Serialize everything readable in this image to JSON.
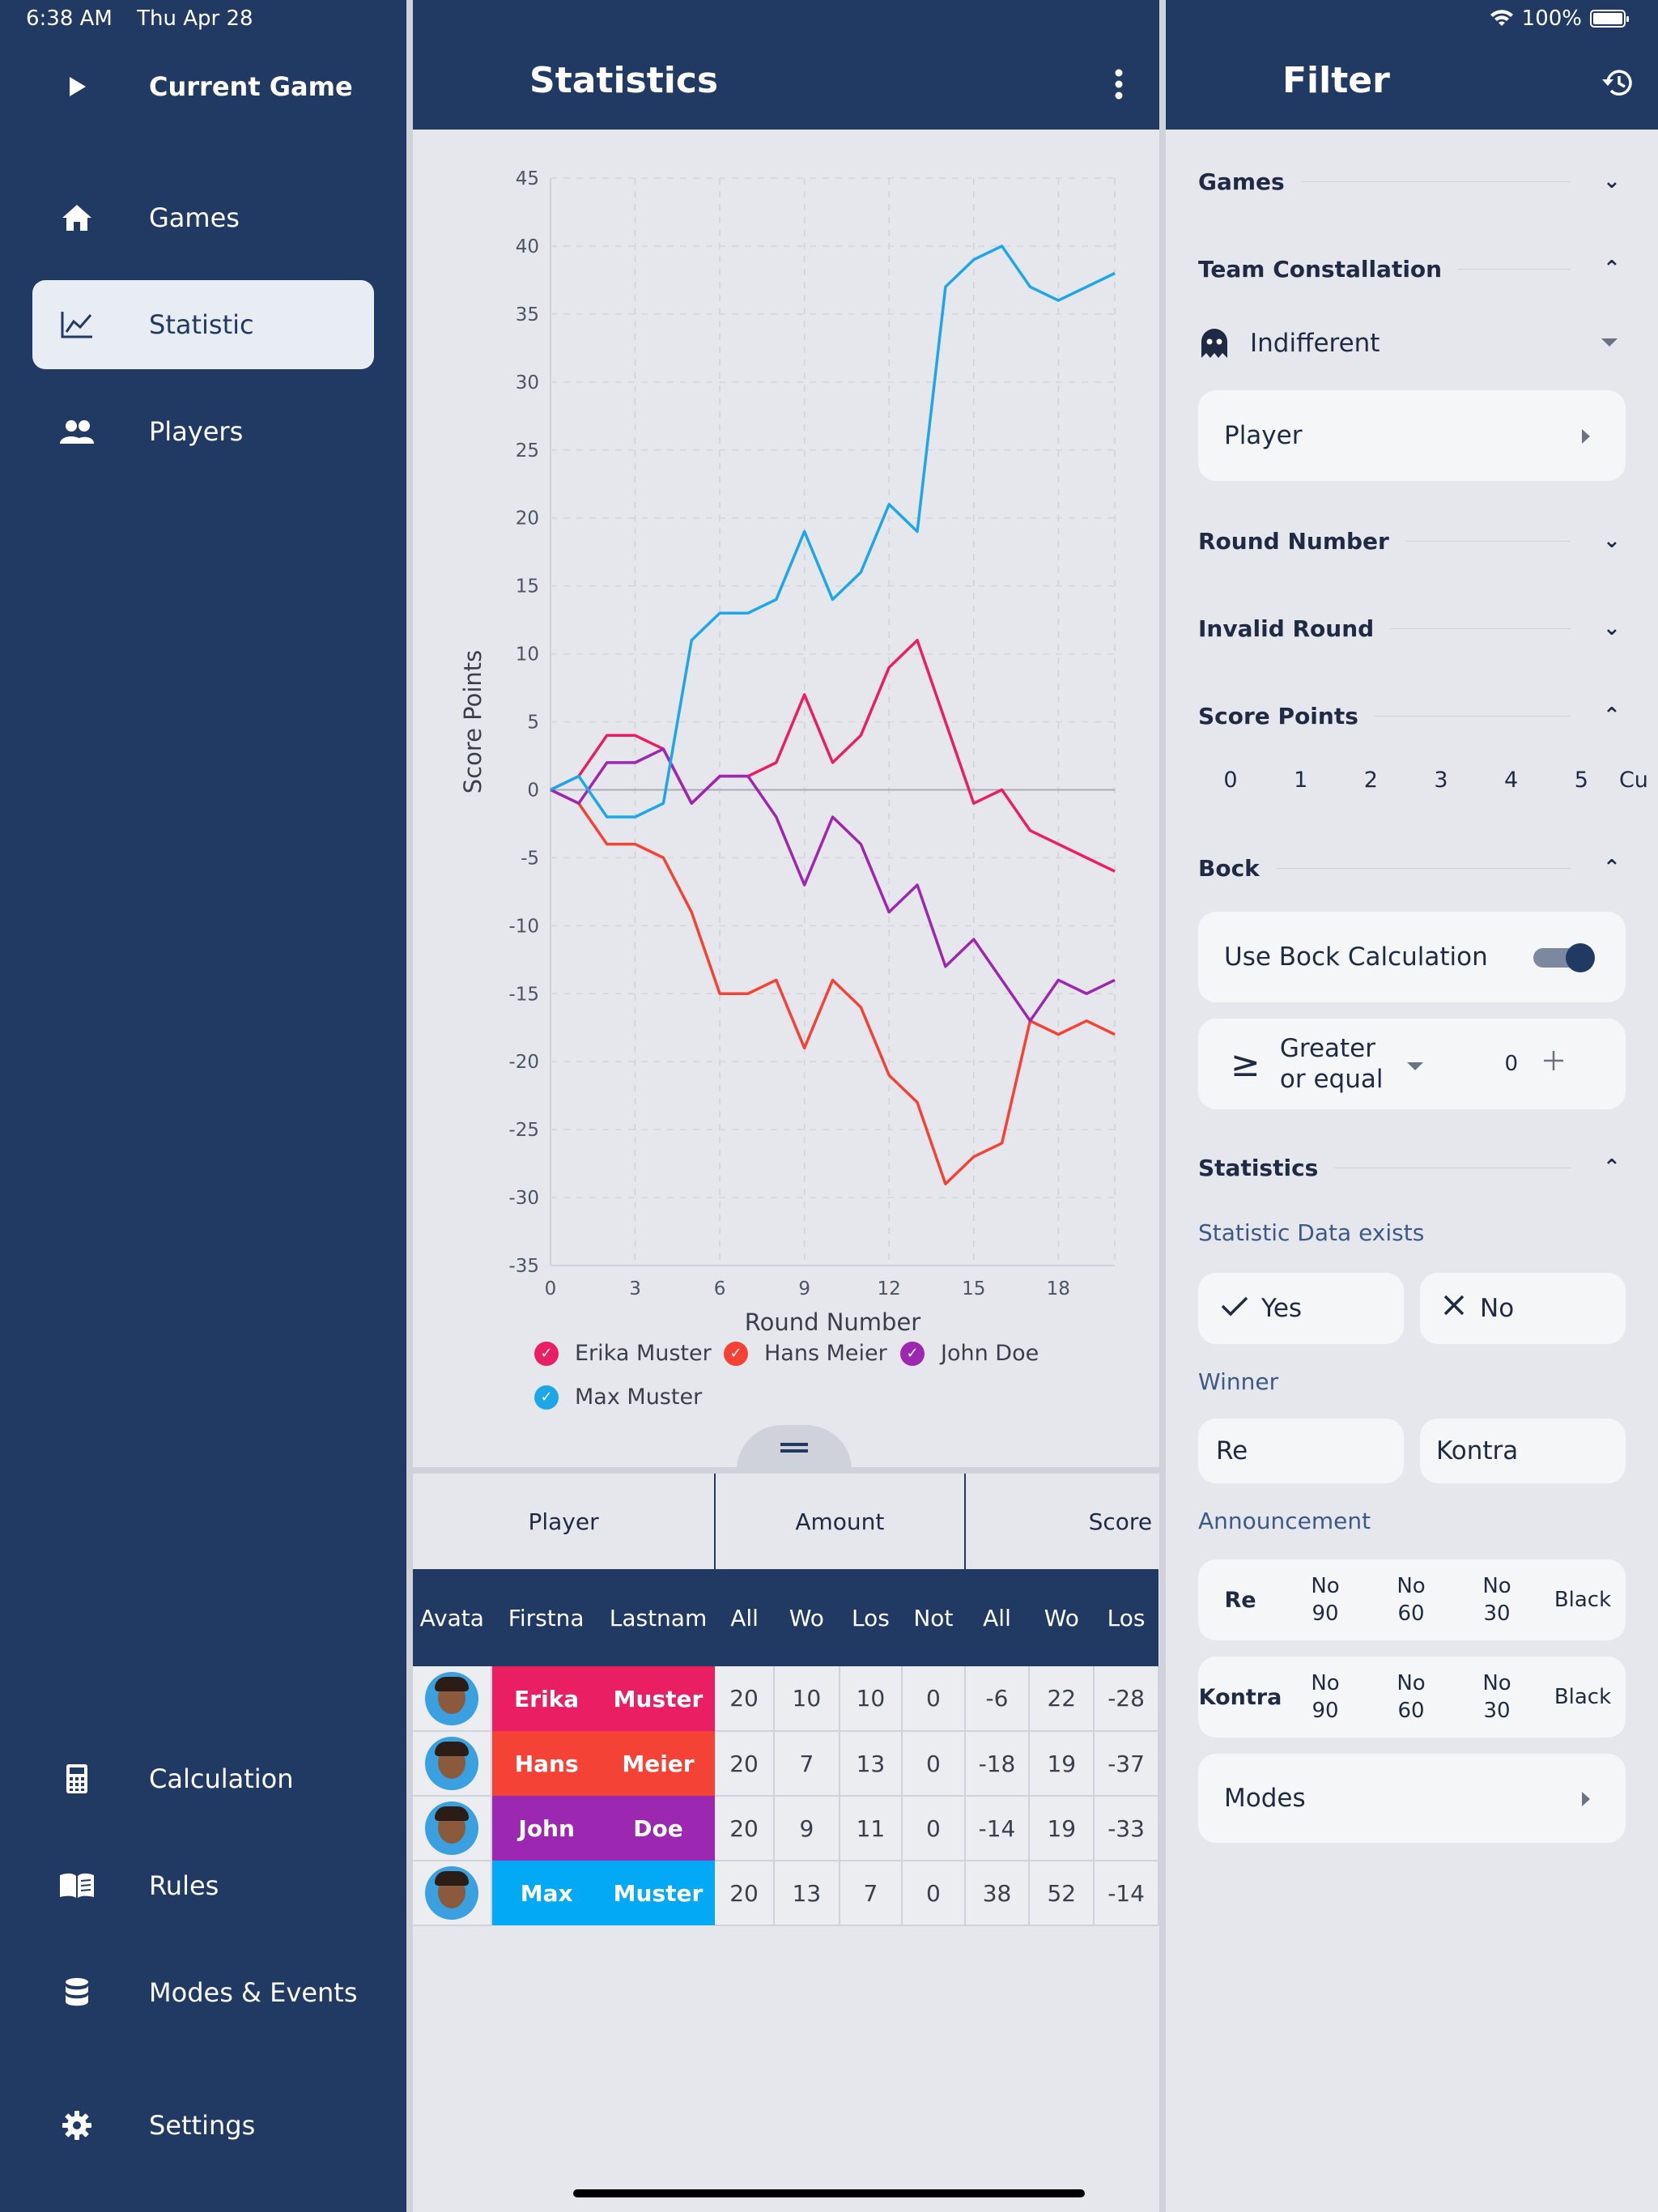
{
  "status": {
    "time": "6:38 AM",
    "date": "Thu Apr 28",
    "battery": "100%"
  },
  "sidebar": {
    "current_game": "Current Game",
    "items": [
      {
        "label": "Games",
        "icon": "home-icon"
      },
      {
        "label": "Statistic",
        "icon": "chart-icon",
        "active": true
      },
      {
        "label": "Players",
        "icon": "people-icon"
      }
    ],
    "bottom_items": [
      {
        "label": "Calculation",
        "icon": "calculator-icon"
      },
      {
        "label": "Rules",
        "icon": "book-icon"
      },
      {
        "label": "Modes & Events",
        "icon": "database-icon"
      },
      {
        "label": "Settings",
        "icon": "gear-icon"
      }
    ]
  },
  "statistics": {
    "title": "Statistics",
    "table": {
      "groups": [
        "Player",
        "Amount",
        "Score"
      ],
      "columns": [
        "Avata",
        "Firstna",
        "Lastnam",
        "All",
        "Wo",
        "Los",
        "Not",
        "All",
        "Wo",
        "Los"
      ],
      "rows": [
        {
          "first": "Erika",
          "last": "Muster",
          "color": "#e91e63",
          "vals": [
            "20",
            "10",
            "10",
            "0",
            "-6",
            "22",
            "-28"
          ]
        },
        {
          "first": "Hans",
          "last": "Meier",
          "color": "#f44336",
          "vals": [
            "20",
            "7",
            "13",
            "0",
            "-18",
            "19",
            "-37"
          ]
        },
        {
          "first": "John",
          "last": "Doe",
          "color": "#9c27b0",
          "vals": [
            "20",
            "9",
            "11",
            "0",
            "-14",
            "19",
            "-33"
          ]
        },
        {
          "first": "Max",
          "last": "Muster",
          "color": "#03a9f4",
          "vals": [
            "20",
            "13",
            "7",
            "0",
            "38",
            "52",
            "-14"
          ]
        }
      ]
    }
  },
  "chart_data": {
    "type": "line",
    "xlabel": "Round Number",
    "ylabel": "Score Points",
    "xlim": [
      0,
      20
    ],
    "ylim": [
      -35,
      45
    ],
    "x_ticks": [
      0,
      3,
      6,
      9,
      12,
      15,
      18
    ],
    "y_ticks": [
      45,
      40,
      35,
      30,
      25,
      20,
      15,
      10,
      5,
      0,
      -5,
      -10,
      -15,
      -20,
      -25,
      -30,
      -35
    ],
    "grid": true,
    "legend_position": "bottom",
    "x": [
      0,
      1,
      2,
      3,
      4,
      5,
      6,
      7,
      8,
      9,
      10,
      11,
      12,
      13,
      14,
      15,
      16,
      17,
      18,
      19,
      20
    ],
    "series": [
      {
        "name": "Erika Muster",
        "color": "#e91e63",
        "values": [
          0,
          1,
          4,
          4,
          3,
          -1,
          1,
          1,
          2,
          7,
          2,
          4,
          9,
          11,
          5,
          -1,
          0,
          -3,
          -4,
          -5,
          -6
        ]
      },
      {
        "name": "Hans Meier",
        "color": "#f44336",
        "values": [
          0,
          -1,
          -4,
          -4,
          -5,
          -9,
          -15,
          -15,
          -14,
          -19,
          -14,
          -16,
          -21,
          -23,
          -29,
          -27,
          -26,
          -17,
          -18,
          -17,
          -18
        ]
      },
      {
        "name": "John Doe",
        "color": "#9c27b0",
        "values": [
          0,
          -1,
          2,
          2,
          3,
          -1,
          1,
          1,
          -2,
          -7,
          -2,
          -4,
          -9,
          -7,
          -13,
          -11,
          -14,
          -17,
          -14,
          -15,
          -14
        ]
      },
      {
        "name": "Max Muster",
        "color": "#1ea7e8",
        "values": [
          0,
          1,
          -2,
          -2,
          -1,
          11,
          13,
          13,
          14,
          19,
          14,
          16,
          21,
          19,
          37,
          39,
          40,
          37,
          36,
          37,
          38
        ]
      }
    ]
  },
  "filter": {
    "title": "Filter",
    "sections": {
      "games": "Games",
      "team": "Team Constallation",
      "round": "Round Number",
      "invalid": "Invalid Round",
      "score": "Score Points",
      "bock": "Bock",
      "statistics": "Statistics"
    },
    "team_select": "Indifferent",
    "player": "Player",
    "score_options": [
      "0",
      "1",
      "2",
      "3",
      "4",
      "5",
      "Cu"
    ],
    "bock_toggle": "Use Bock Calculation",
    "operator_symbol": "≥",
    "operator_line1": "Greater",
    "operator_line2": "or equal",
    "bock_value": "0",
    "stat_exists_label": "Statistic Data exists",
    "yes": "Yes",
    "no": "No",
    "winner_label": "Winner",
    "re": "Re",
    "kontra": "Kontra",
    "announcement_label": "Announcement",
    "announce_re": "Re",
    "announce_kontra": "Kontra",
    "announce_options": [
      [
        "No",
        "90"
      ],
      [
        "No",
        "60"
      ],
      [
        "No",
        "30"
      ]
    ],
    "black": "Black",
    "modes": "Modes",
    "toggle_color": "#213a63"
  }
}
